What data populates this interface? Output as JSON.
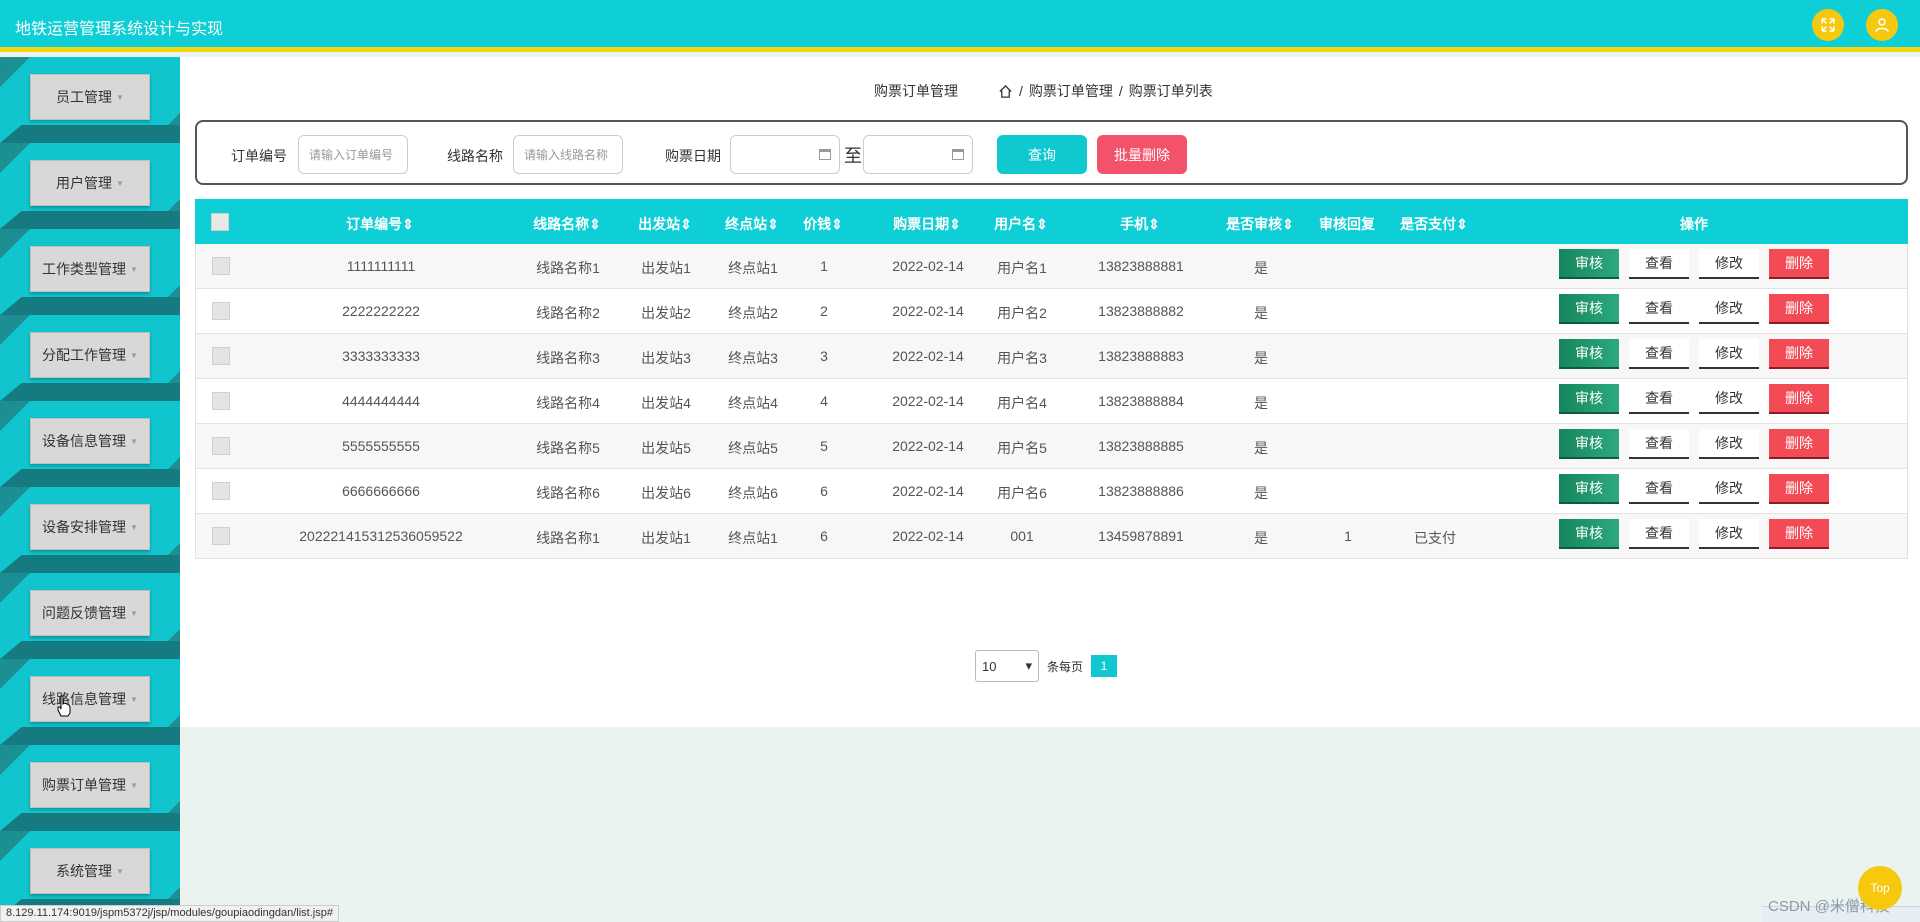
{
  "header": {
    "title": "地铁运营管理系统设计与实现",
    "fullscreen_icon": "expand-arrows-icon",
    "user_icon": "user-icon"
  },
  "sidebar": {
    "items": [
      {
        "label": "员工管理"
      },
      {
        "label": "用户管理"
      },
      {
        "label": "工作类型管理"
      },
      {
        "label": "分配工作管理"
      },
      {
        "label": "设备信息管理"
      },
      {
        "label": "设备安排管理"
      },
      {
        "label": "问题反馈管理"
      },
      {
        "label": "线路信息管理"
      },
      {
        "label": "购票订单管理"
      },
      {
        "label": "系统管理"
      }
    ]
  },
  "breadcrumb": {
    "title": "购票订单管理",
    "path": [
      "购票订单管理",
      "购票订单列表"
    ],
    "separator": "/"
  },
  "search": {
    "order_no_label": "订单编号",
    "order_no_placeholder": "请输入订单编号",
    "line_label": "线路名称",
    "line_placeholder": "请输入线路名称",
    "date_label": "购票日期",
    "date_to": "至",
    "query_button": "查询",
    "batch_delete_button": "批量删除"
  },
  "table": {
    "columns": [
      "订单编号",
      "线路名称",
      "出发站",
      "终点站",
      "价钱",
      "购票日期",
      "用户名",
      "手机",
      "是否审核",
      "审核回复",
      "是否支付",
      "操作"
    ],
    "sortable_marker": "⇕",
    "actions": {
      "audit": "审核",
      "view": "查看",
      "edit": "修改",
      "delete": "删除"
    },
    "rows": [
      {
        "order_no": "1111111111",
        "line": "线路名称1",
        "from": "出发站1",
        "to": "终点站1",
        "price": "1",
        "date": "2022-02-14",
        "user": "用户名1",
        "phone": "13823888881",
        "audited": "是",
        "reply": "",
        "paid": ""
      },
      {
        "order_no": "2222222222",
        "line": "线路名称2",
        "from": "出发站2",
        "to": "终点站2",
        "price": "2",
        "date": "2022-02-14",
        "user": "用户名2",
        "phone": "13823888882",
        "audited": "是",
        "reply": "",
        "paid": ""
      },
      {
        "order_no": "3333333333",
        "line": "线路名称3",
        "from": "出发站3",
        "to": "终点站3",
        "price": "3",
        "date": "2022-02-14",
        "user": "用户名3",
        "phone": "13823888883",
        "audited": "是",
        "reply": "",
        "paid": ""
      },
      {
        "order_no": "4444444444",
        "line": "线路名称4",
        "from": "出发站4",
        "to": "终点站4",
        "price": "4",
        "date": "2022-02-14",
        "user": "用户名4",
        "phone": "13823888884",
        "audited": "是",
        "reply": "",
        "paid": ""
      },
      {
        "order_no": "5555555555",
        "line": "线路名称5",
        "from": "出发站5",
        "to": "终点站5",
        "price": "5",
        "date": "2022-02-14",
        "user": "用户名5",
        "phone": "13823888885",
        "audited": "是",
        "reply": "",
        "paid": ""
      },
      {
        "order_no": "6666666666",
        "line": "线路名称6",
        "from": "出发站6",
        "to": "终点站6",
        "price": "6",
        "date": "2022-02-14",
        "user": "用户名6",
        "phone": "13823888886",
        "audited": "是",
        "reply": "",
        "paid": ""
      },
      {
        "order_no": "202221415312536059522",
        "line": "线路名称1",
        "from": "出发站1",
        "to": "终点站1",
        "price": "6",
        "date": "2022-02-14",
        "user": "001",
        "phone": "13459878891",
        "audited": "是",
        "reply": "1",
        "paid": "已支付"
      }
    ]
  },
  "pagination": {
    "page_size": "10",
    "per_page_label": "条每页",
    "current_page": "1"
  },
  "status_bar": {
    "url": "8.129.11.174:9019/jspm5372j/jsp/modules/goupiaodingdan/list.jsp#"
  },
  "back_to_top": "Top",
  "watermark": "CSDN @米僧科技",
  "colors": {
    "primary": "#0ecfd6",
    "accent_yellow": "#f6c90e",
    "danger": "#f24b55",
    "audit_green": "#1e9d6e"
  }
}
